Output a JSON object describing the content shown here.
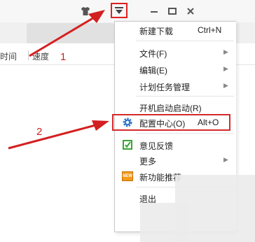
{
  "window": {
    "columns": {
      "time": "时间",
      "speed": "速度"
    },
    "tab_close_glyph": "×"
  },
  "menu": {
    "items": [
      {
        "label": "新建下载",
        "shortcut": "Ctrl+N"
      },
      {
        "label": "文件(F)",
        "submenu": true
      },
      {
        "label": "编辑(E)",
        "submenu": true
      },
      {
        "label": "计划任务管理",
        "submenu": true
      },
      {
        "label": "开机启动启动(R)"
      },
      {
        "label": "配置中心(O)",
        "shortcut": "Alt+O",
        "icon": "gear-icon",
        "highlighted": true
      },
      {
        "label": "意见反馈",
        "icon": "feedback-icon"
      },
      {
        "label": "更多",
        "submenu": true
      },
      {
        "label": "新功能推荐",
        "icon": "new-badge-icon"
      },
      {
        "label": "退出"
      }
    ],
    "new_badge_text": "NEW"
  },
  "annotations": {
    "step1": "1",
    "step2": "2"
  },
  "colors": {
    "accent_red": "#d42a2a",
    "gear_blue": "#2a72c8",
    "feedback_green": "#3aa535",
    "badge_orange": "#f39a1b"
  }
}
